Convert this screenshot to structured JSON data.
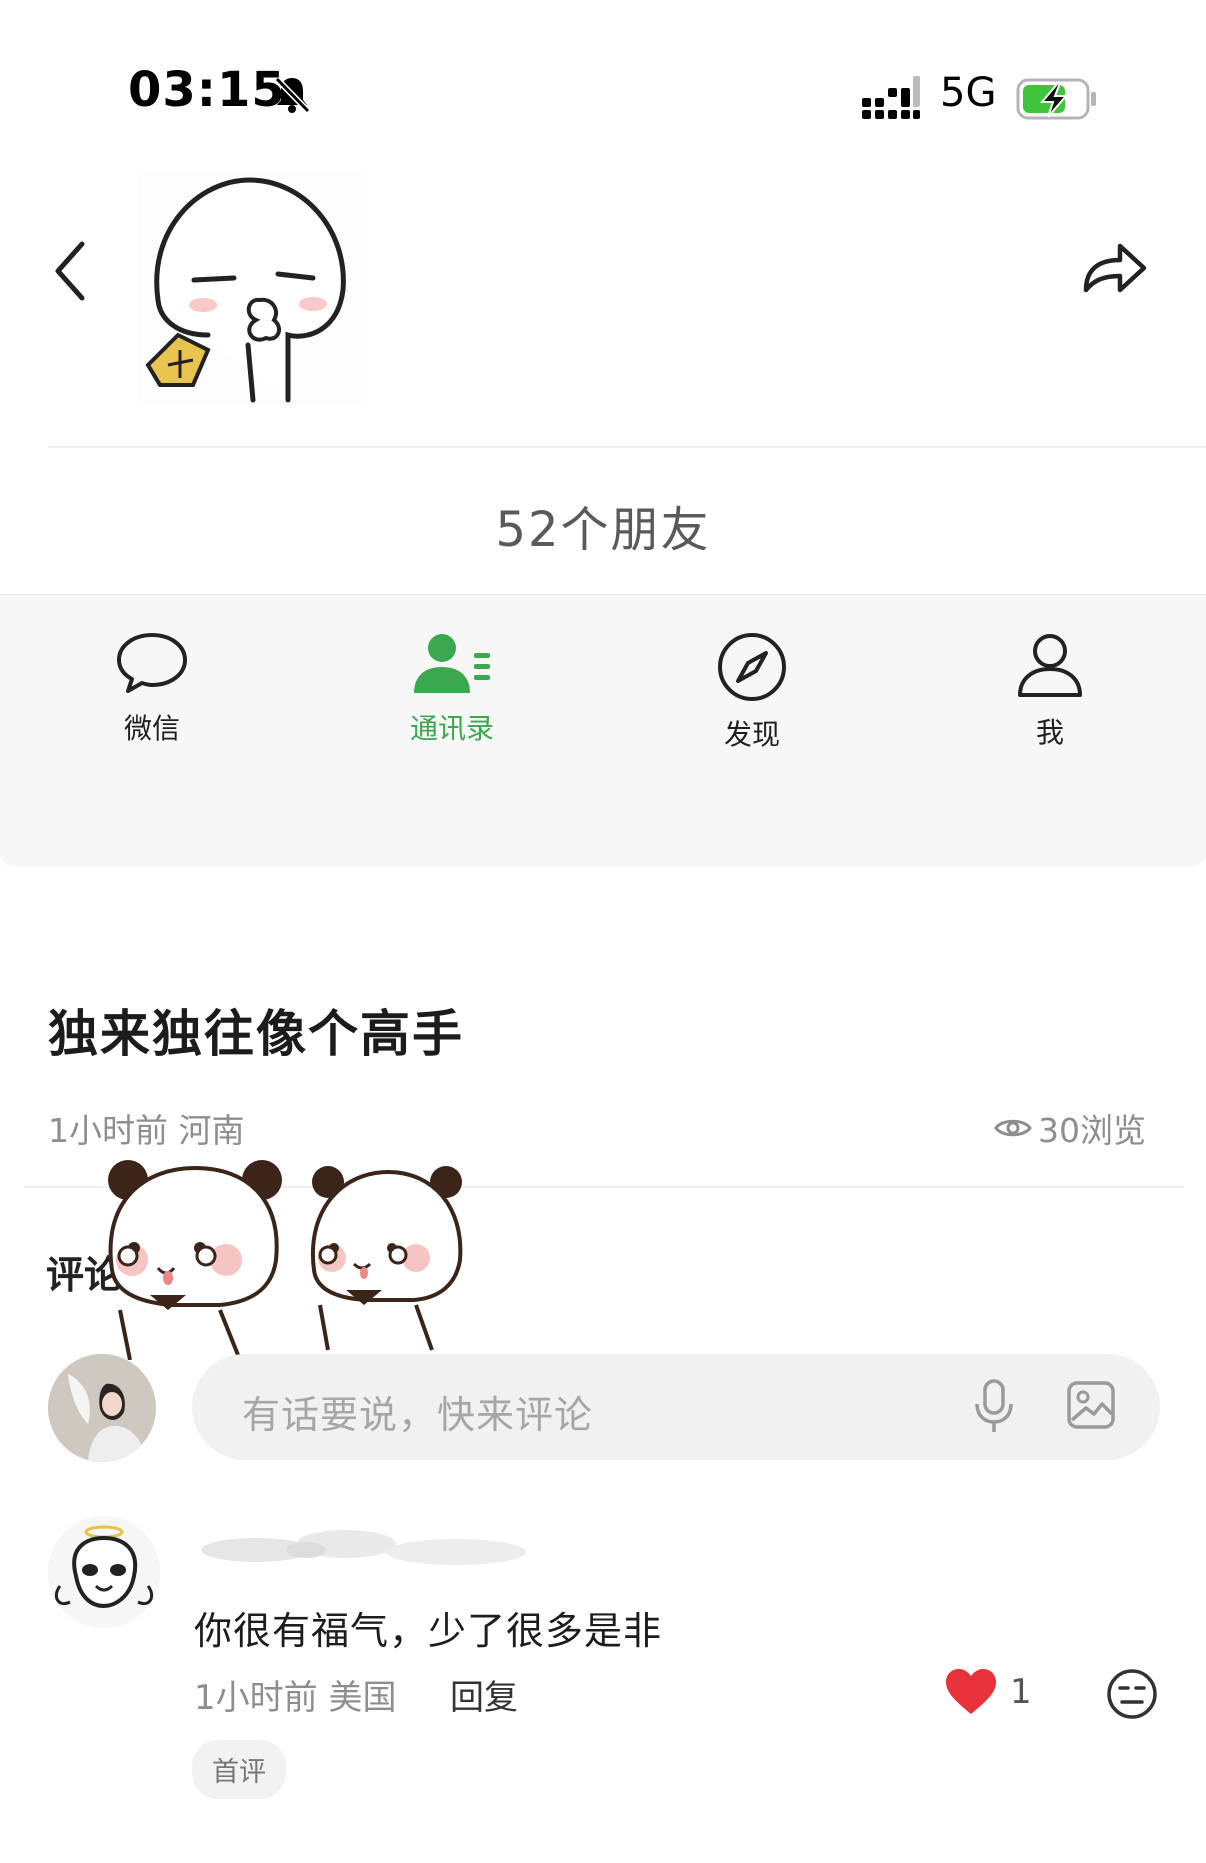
{
  "status_bar": {
    "time": "03:15",
    "network": "5G",
    "icons": [
      "bell-muted-icon",
      "signal-icon",
      "battery-charging-icon"
    ]
  },
  "header": {
    "back_icon": "chevron-left-icon",
    "share_icon": "share-arrow-icon",
    "avatar": "sticker-avatar"
  },
  "friend_count": "52个朋友",
  "tabs": [
    {
      "label": "微信",
      "icon": "chat-bubble-icon",
      "active": false
    },
    {
      "label": "通讯录",
      "icon": "contacts-icon",
      "active": true
    },
    {
      "label": "发现",
      "icon": "compass-icon",
      "active": false
    },
    {
      "label": "我",
      "icon": "person-icon",
      "active": false
    }
  ],
  "post": {
    "title": "独来独往像个高手",
    "meta": "1小时前 河南",
    "views": "30浏览"
  },
  "comments_section": {
    "heading": "评论和收藏",
    "input_placeholder": "有话要说，快来评论"
  },
  "comment": {
    "text": "你很有福气，少了很多是非",
    "meta": "1小时前 美国",
    "reply_label": "回复",
    "like_count": "1",
    "badge": "首评"
  },
  "colors": {
    "accent_green": "#3aa84e",
    "like_red": "#e8313a",
    "muted_text": "#8e8e8e"
  }
}
